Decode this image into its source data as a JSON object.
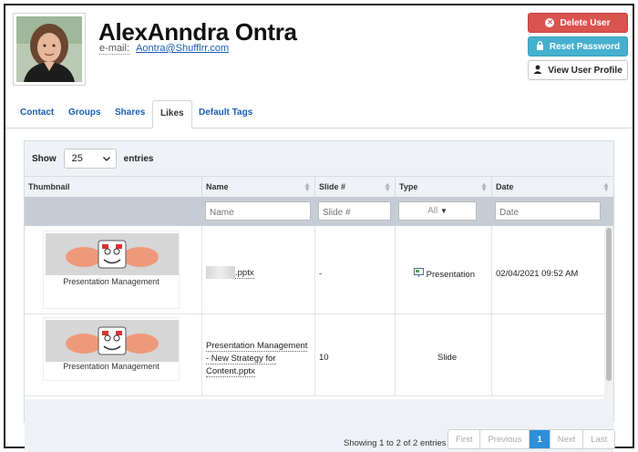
{
  "user": {
    "name": "AlexAnndra Ontra",
    "email_label": "e-mail:",
    "email": "Aontra@Shufflrr.com"
  },
  "actions": {
    "delete_label": "Delete User",
    "reset_label": "Reset Password",
    "profile_label": "View User Profile",
    "colors": {
      "delete": "#d9534f",
      "reset": "#46b0cf"
    }
  },
  "tabs": [
    {
      "label": "Contact"
    },
    {
      "label": "Groups"
    },
    {
      "label": "Shares"
    },
    {
      "label": "Likes"
    },
    {
      "label": "Default Tags"
    }
  ],
  "active_tab": "Likes",
  "table": {
    "show_label": "Show",
    "entries_label": "entries",
    "page_size": "25",
    "columns": [
      {
        "label": "Thumbnail"
      },
      {
        "label": "Name"
      },
      {
        "label": "Slide #"
      },
      {
        "label": "Type"
      },
      {
        "label": "Date"
      }
    ],
    "filters": {
      "name_placeholder": "Name",
      "slide_placeholder": "Slide #",
      "type_selected": "All",
      "date_placeholder": "Date"
    },
    "rows": [
      {
        "thumbnail_caption": "Presentation Management",
        "name": ".pptx",
        "slide": "-",
        "type": "Presentation",
        "type_icon": "presentation-icon",
        "date": "02/04/2021 09:52 AM"
      },
      {
        "thumbnail_caption": "Presentation Management",
        "name": "Presentation Management - New Strategy for Content.pptx",
        "slide": "10",
        "type": "Slide",
        "date": ""
      }
    ],
    "info": "Showing 1 to 2 of 2 entries",
    "pager": {
      "first": "First",
      "previous": "Previous",
      "current": "1",
      "next": "Next",
      "last": "Last"
    },
    "accent": "#2d8fd9"
  }
}
